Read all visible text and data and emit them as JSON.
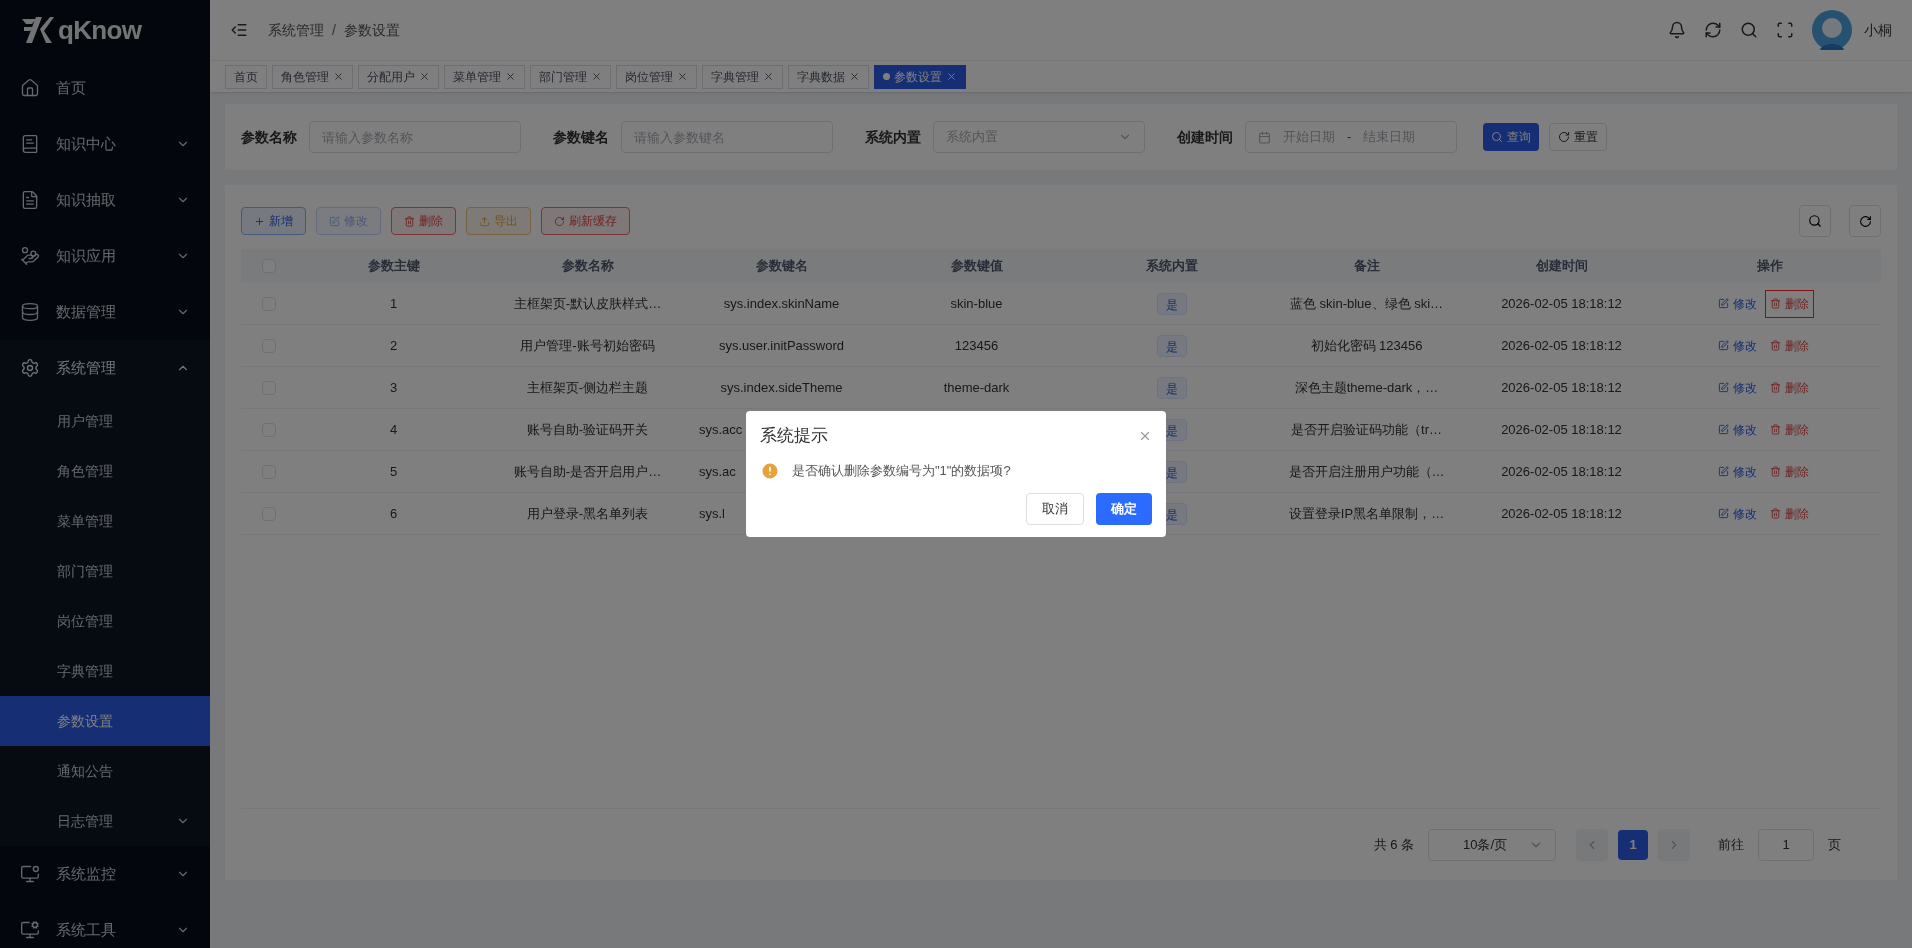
{
  "logo": {
    "text": "qKnow"
  },
  "sidebar": {
    "items": [
      {
        "label": "首页",
        "expanded": false,
        "has_children": false
      },
      {
        "label": "知识中心",
        "expanded": false,
        "has_children": true
      },
      {
        "label": "知识抽取",
        "expanded": false,
        "has_children": true
      },
      {
        "label": "知识应用",
        "expanded": false,
        "has_children": true
      },
      {
        "label": "数据管理",
        "expanded": false,
        "has_children": true
      },
      {
        "label": "系统管理",
        "expanded": true,
        "has_children": true,
        "children": [
          {
            "label": "用户管理",
            "selected": false,
            "has_children": false
          },
          {
            "label": "角色管理",
            "selected": false,
            "has_children": false
          },
          {
            "label": "菜单管理",
            "selected": false,
            "has_children": false
          },
          {
            "label": "部门管理",
            "selected": false,
            "has_children": false
          },
          {
            "label": "岗位管理",
            "selected": false,
            "has_children": false
          },
          {
            "label": "字典管理",
            "selected": false,
            "has_children": false
          },
          {
            "label": "参数设置",
            "selected": true,
            "has_children": false
          },
          {
            "label": "通知公告",
            "selected": false,
            "has_children": false
          },
          {
            "label": "日志管理",
            "selected": false,
            "has_children": true
          }
        ]
      },
      {
        "label": "系统监控",
        "expanded": false,
        "has_children": true
      },
      {
        "label": "系统工具",
        "expanded": false,
        "has_children": true
      }
    ]
  },
  "breadcrumb": [
    "系统管理",
    "参数设置"
  ],
  "breadcrumb_separator": "/",
  "user": {
    "name": "小桐"
  },
  "tabs": [
    {
      "label": "首页",
      "selected": false,
      "closable": false
    },
    {
      "label": "角色管理",
      "selected": false,
      "closable": true
    },
    {
      "label": "分配用户",
      "selected": false,
      "closable": true
    },
    {
      "label": "菜单管理",
      "selected": false,
      "closable": true
    },
    {
      "label": "部门管理",
      "selected": false,
      "closable": true
    },
    {
      "label": "岗位管理",
      "selected": false,
      "closable": true
    },
    {
      "label": "字典管理",
      "selected": false,
      "closable": true
    },
    {
      "label": "字典数据",
      "selected": false,
      "closable": true
    },
    {
      "label": "参数设置",
      "selected": true,
      "closable": true
    }
  ],
  "filters": [
    {
      "kind": "text",
      "label": "参数名称",
      "placeholder": "请输入参数名称"
    },
    {
      "kind": "text",
      "label": "参数键名",
      "placeholder": "请输入参数键名"
    },
    {
      "kind": "select",
      "label": "系统内置",
      "placeholder": "系统内置"
    },
    {
      "kind": "daterange",
      "label": "创建时间",
      "placeholder": "开始日期",
      "placeholder_end": "结束日期",
      "separator": "-"
    }
  ],
  "search_button": "查询",
  "reset_button": "重置",
  "toolbar": [
    {
      "kind": "primary",
      "label": "新增",
      "disabled": false
    },
    {
      "kind": "success",
      "label": "修改",
      "disabled": true
    },
    {
      "kind": "danger",
      "label": "删除",
      "disabled": false
    },
    {
      "kind": "warning",
      "label": "导出",
      "disabled": false
    },
    {
      "kind": "danger",
      "label": "刷新缓存",
      "disabled": false
    }
  ],
  "table": {
    "all_checked": false,
    "columns": [
      "参数主键",
      "参数名称",
      "参数键名",
      "参数键值",
      "系统内置",
      "备注",
      "创建时间",
      "操作"
    ],
    "rows": [
      {
        "id": "1",
        "name": "主框架页-默认皮肤样式…",
        "key": "sys.index.skinName",
        "value": "skin-blue",
        "builtin": "是",
        "remark": "蓝色 skin-blue、绿色 ski…",
        "created": "2026-02-05 18:18:12",
        "covered": false,
        "checked": false,
        "edit": "修改",
        "delete": "删除",
        "delete_focused": true
      },
      {
        "id": "2",
        "name": "用户管理-账号初始密码",
        "key": "sys.user.initPassword",
        "value": "123456",
        "builtin": "是",
        "remark": "初始化密码 123456",
        "created": "2026-02-05 18:18:12",
        "covered": false,
        "checked": false,
        "edit": "修改",
        "delete": "删除",
        "delete_focused": false
      },
      {
        "id": "3",
        "name": "主框架页-侧边栏主题",
        "key": "sys.index.sideTheme",
        "value": "theme-dark",
        "builtin": "是",
        "remark": "深色主题theme-dark，…",
        "created": "2026-02-05 18:18:12",
        "covered": false,
        "checked": false,
        "edit": "修改",
        "delete": "删除",
        "delete_focused": false
      },
      {
        "id": "4",
        "name": "账号自助-验证码开关",
        "key": "sys.acc",
        "builtin": "是",
        "remark": "是否开启验证码功能（tr…",
        "created": "2026-02-05 18:18:12",
        "covered": true,
        "checked": false,
        "edit": "修改",
        "delete": "删除",
        "delete_focused": false
      },
      {
        "id": "5",
        "name": "账号自助-是否开启用户…",
        "key": "sys.ac",
        "builtin": "是",
        "remark": "是否开启注册用户功能（…",
        "created": "2026-02-05 18:18:12",
        "covered": true,
        "checked": false,
        "edit": "修改",
        "delete": "删除",
        "delete_focused": false
      },
      {
        "id": "6",
        "name": "用户登录-黑名单列表",
        "key": "sys.l",
        "builtin": "是",
        "remark": "设置登录IP黑名单限制，…",
        "created": "2026-02-05 18:18:12",
        "covered": true,
        "checked": false,
        "edit": "修改",
        "delete": "删除",
        "delete_focused": false
      }
    ]
  },
  "pagination": {
    "total": "共 6 条",
    "page_size": "10条/页",
    "pages": [
      {
        "label": "1",
        "selected": true
      }
    ],
    "goto_label": "前往",
    "goto_value": "1",
    "goto_suffix": "页"
  },
  "dialog": {
    "title": "系统提示",
    "message": "是否确认删除参数编号为\"1\"的数据项?",
    "cancel": "取消",
    "confirm": "确定"
  }
}
